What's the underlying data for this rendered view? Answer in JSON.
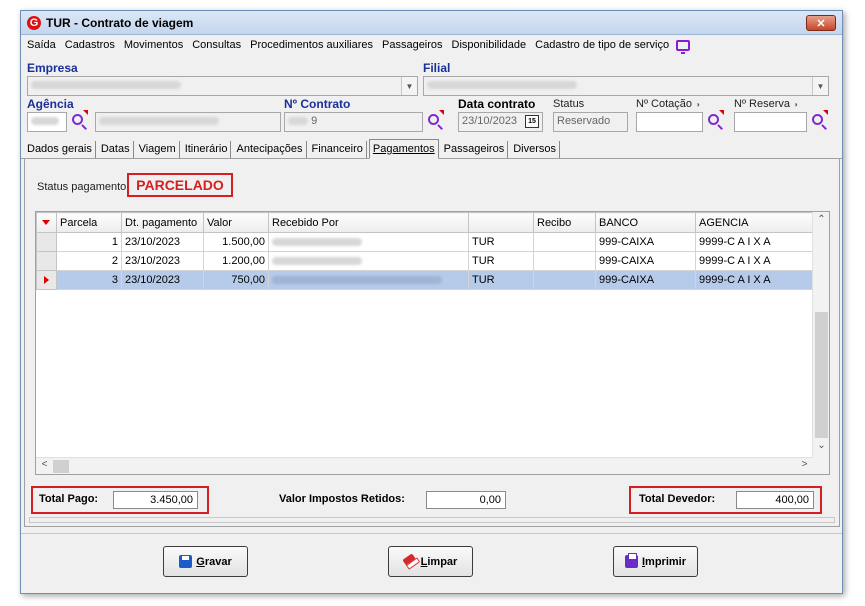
{
  "window": {
    "title": "TUR - Contrato de viagem",
    "logo_letter": "G",
    "close_glyph": "✕"
  },
  "menu": [
    "Saída",
    "Cadastros",
    "Movimentos",
    "Consultas",
    "Procedimentos auxiliares",
    "Passageiros",
    "Disponibilidade",
    "Cadastro de tipo de serviço"
  ],
  "form": {
    "empresa_label": "Empresa",
    "filial_label": "Filial",
    "agencia_label": "Agência",
    "contrato_label": "Nº Contrato",
    "contrato_value": "9",
    "data_contrato_label": "Data contrato",
    "data_contrato_value": "23/10/2023",
    "calendar_glyph": "15",
    "status_label": "Status",
    "status_value": "Reservado",
    "cotacao_label": "Nº Cotação",
    "reserva_label": "Nº Reserva"
  },
  "tabs": [
    "Dados gerais",
    "Datas",
    "Viagem",
    "Itinerário",
    "Antecipações",
    "Financeiro",
    "Pagamentos",
    "Passageiros",
    "Diversos"
  ],
  "active_tab": "Pagamentos",
  "payments": {
    "status_label": "Status pagamento:",
    "status_value": "PARCELADO",
    "columns": [
      "Parcela",
      "Dt. pagamento",
      "Valor",
      "Recebido Por",
      "",
      "Recibo",
      "BANCO",
      "AGENCIA"
    ],
    "rows": [
      {
        "parcela": "1",
        "dt": "23/10/2023",
        "valor": "1.500,00",
        "tipo": "TUR",
        "recibo": "",
        "banco": "999-CAIXA",
        "agencia": "9999-C A I X A"
      },
      {
        "parcela": "2",
        "dt": "23/10/2023",
        "valor": "1.200,00",
        "tipo": "TUR",
        "recibo": "",
        "banco": "999-CAIXA",
        "agencia": "9999-C A I X A"
      },
      {
        "parcela": "3",
        "dt": "23/10/2023",
        "valor": "750,00",
        "tipo": "TUR",
        "recibo": "",
        "banco": "999-CAIXA",
        "agencia": "9999-C A I X A"
      }
    ],
    "selected_row": 2,
    "total_pago_label": "Total Pago:",
    "total_pago_value": "3.450,00",
    "impostos_label": "Valor Impostos Retidos:",
    "impostos_value": "0,00",
    "total_devedor_label": "Total Devedor:",
    "total_devedor_value": "400,00"
  },
  "buttons": {
    "gravar_first": "G",
    "gravar_rest": "ravar",
    "limpar_first": "L",
    "limpar_rest": "impar",
    "imprimir_first": "I",
    "imprimir_rest": "mprimir"
  },
  "colors": {
    "accent_red": "#d42020",
    "selection": "#b6cbe9",
    "label_blue": "#1a2f9a",
    "icon_purple": "#7d2cd0"
  }
}
